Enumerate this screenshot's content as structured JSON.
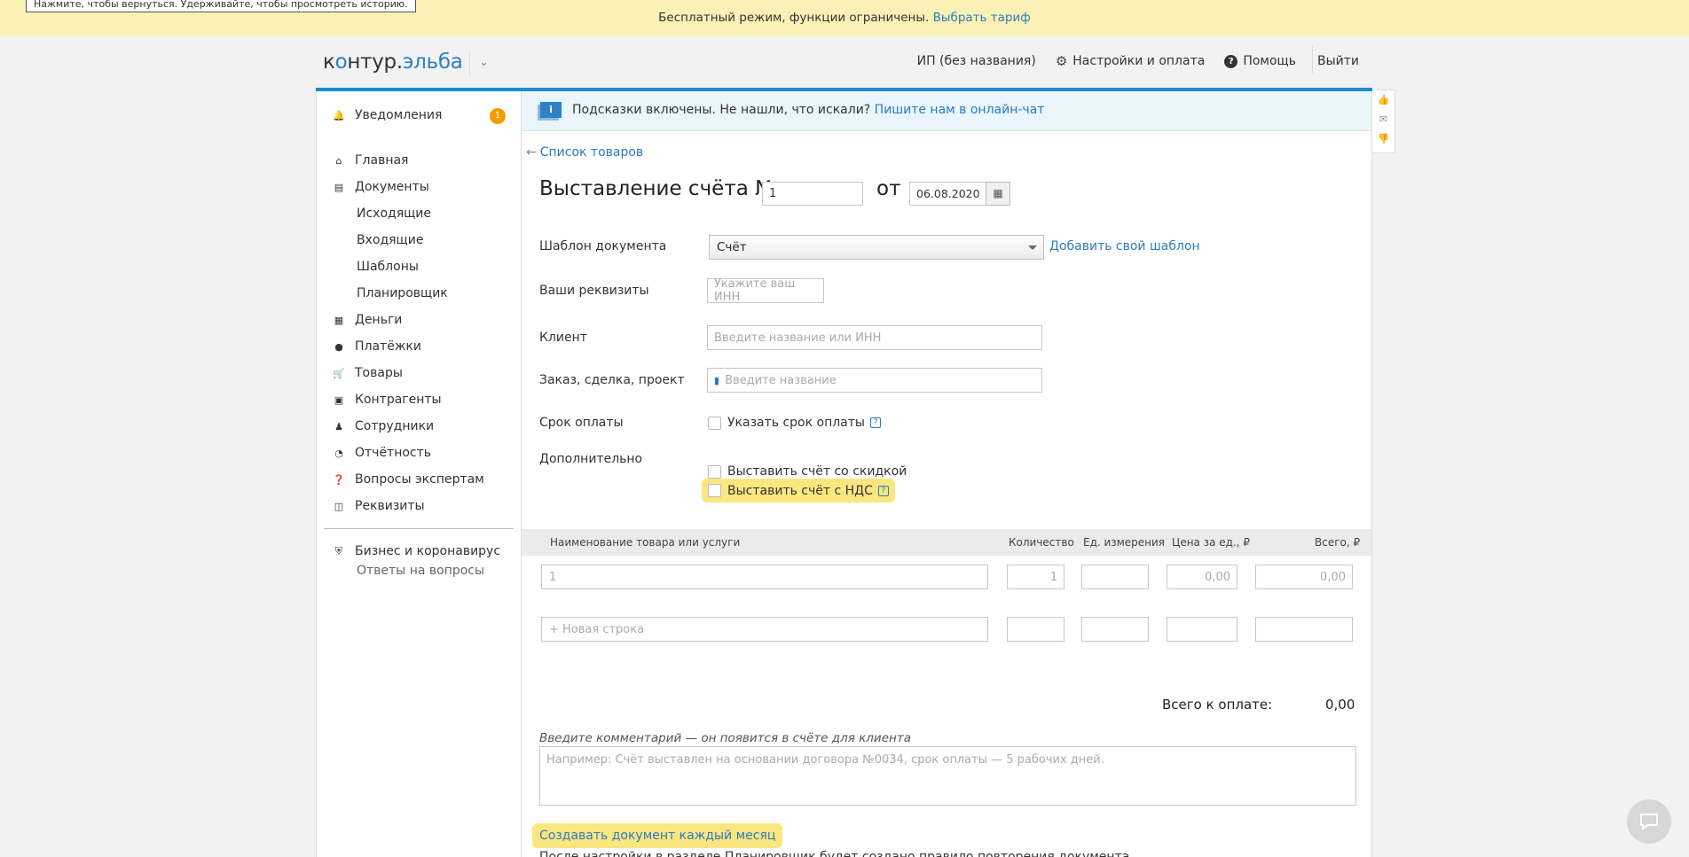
{
  "tooltip": "Нажмите, чтобы вернуться. Удерживайте, чтобы просмотреть историю.",
  "topbar": {
    "text": "Бесплатный режим, функции ограничены.",
    "link": "Выбрать тариф"
  },
  "header": {
    "logo_pre": "к",
    "logo_o": "о",
    "logo_mid": "нтур.",
    "logo_brand": "эльба",
    "org": "ИП (без названия)",
    "settings": "Настройки и оплата",
    "help": "Помощь",
    "logout": "Выйти"
  },
  "sidebar": {
    "notifications": "Уведомления",
    "notif_count": "1",
    "main": "Главная",
    "documents": "Документы",
    "outgoing": "Исходящие",
    "incoming": "Входящие",
    "templates": "Шаблоны",
    "planner": "Планировщик",
    "money": "Деньги",
    "payments": "Платёжки",
    "goods": "Товары",
    "contractors": "Контрагенты",
    "employees": "Сотрудники",
    "reports": "Отчётность",
    "experts": "Вопросы экспертам",
    "requisites": "Реквизиты",
    "covid": "Бизнес и коронавирус",
    "covid_sub": "Ответы на вопросы"
  },
  "hint": {
    "icon": "i",
    "text": "Подсказки включены. Не нашли, что искали?",
    "link": "Пишите нам в онлайн-чат"
  },
  "form": {
    "back": "Список товаров",
    "title": "Выставление счёта №",
    "number": "1",
    "from": "от",
    "date": "06.08.2020",
    "template_label": "Шаблон документа",
    "template_value": "Счёт",
    "add_template": "Добавить свой шаблон",
    "requisites_label": "Ваши реквизиты",
    "inn_placeholder": "Укажите ваш ИНН",
    "client_label": "Клиент",
    "client_placeholder": "Введите название или ИНН",
    "order_label": "Заказ, сделка, проект",
    "order_placeholder": "Введите название",
    "due_label": "Срок оплаты",
    "due_checkbox": "Указать срок оплаты",
    "extra_label": "Дополнительно",
    "discount_checkbox": "Выставить счёт со скидкой",
    "vat_checkbox": "Выставить счёт с НДС"
  },
  "table": {
    "headers": [
      "Наименование товара или услуги",
      "Количество",
      "Ед. измерения",
      "Цена за ед., ₽",
      "Всего, ₽"
    ],
    "row1": {
      "name": "1",
      "qty": "1",
      "unit": "",
      "price": "0,00",
      "total": "0,00"
    },
    "new_row": "+ Новая строка"
  },
  "total": {
    "label": "Всего к оплате:",
    "value": "0,00"
  },
  "comment": {
    "label": "Введите комментарий — он появится в счёте для клиента",
    "placeholder": "Например: Счёт выставлен на основании договора №0034, срок оплаты — 5 рабочих дней."
  },
  "repeat": "Создавать документ каждый месяц",
  "cut_text": "После настройки в разделе Планировщик будет создано правило повторения документа"
}
